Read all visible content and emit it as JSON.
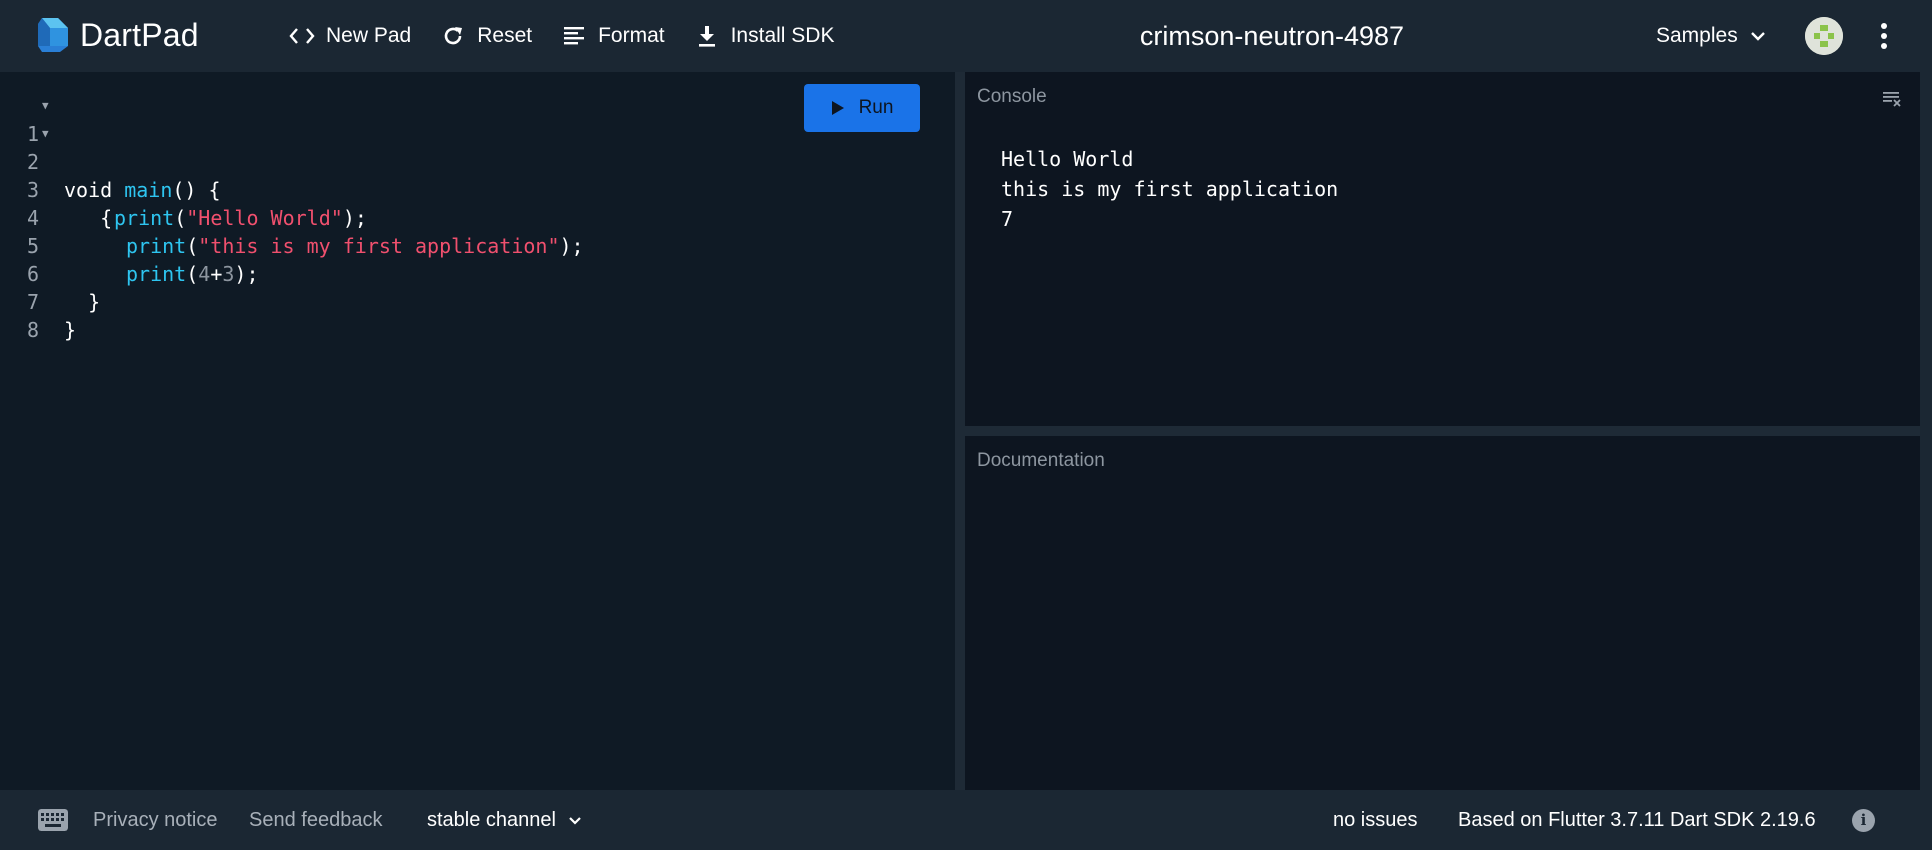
{
  "app": {
    "name": "DartPad",
    "pad_name": "crimson-neutron-4987"
  },
  "toolbar": {
    "new_pad": "New Pad",
    "reset": "Reset",
    "format": "Format",
    "install_sdk": "Install SDK",
    "samples": "Samples"
  },
  "editor": {
    "run_label": "Run",
    "lines": [
      {
        "num": "1",
        "fold": true
      },
      {
        "num": "2",
        "fold": true
      },
      {
        "num": "3",
        "fold": false
      },
      {
        "num": "4",
        "fold": false
      },
      {
        "num": "5",
        "fold": false
      },
      {
        "num": "6",
        "fold": false
      },
      {
        "num": "7",
        "fold": false
      },
      {
        "num": "8",
        "fold": false
      }
    ],
    "tokens": {
      "l1_void": "void ",
      "l1_main": "main",
      "l1_rest": "() {",
      "l2": "   {",
      "l3_fn": "print",
      "l3_open": "(",
      "l3_str": "\"Hello World\"",
      "l3_close": ");",
      "l4_fn": "print",
      "l4_open": "(",
      "l4_str": "\"this is my first application\"",
      "l4_close": ");",
      "l5_fn": "print",
      "l5_open": "(",
      "l5_n1": "4",
      "l5_op": "+",
      "l5_n2": "3",
      "l5_close": ");",
      "l6": "  }",
      "l7": "}",
      "l8": ""
    }
  },
  "console": {
    "title": "Console",
    "output": [
      "Hello World",
      "this is my first application",
      "7"
    ]
  },
  "docs": {
    "title": "Documentation"
  },
  "footer": {
    "privacy": "Privacy notice",
    "feedback": "Send feedback",
    "channel": "stable channel",
    "issues": "no issues",
    "version": "Based on Flutter 3.7.11 Dart SDK 2.19.6"
  },
  "colors": {
    "accent": "#1a73e8",
    "function": "#2ec5f0",
    "string": "#f0506e"
  }
}
